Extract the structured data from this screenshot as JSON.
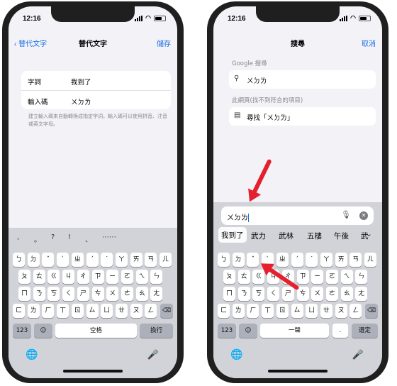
{
  "left": {
    "status": {
      "time": "12:16"
    },
    "nav": {
      "back": "替代文字",
      "title": "替代文字",
      "action": "儲存"
    },
    "form": {
      "phrase_label": "字詞",
      "phrase_value": "我到了",
      "input_label": "輸入碼",
      "input_value": "ㄨㄉㄌ"
    },
    "hint": "建立輸入碼來自動轉換成指定字詞。輸入碼可以使用拼音、注音或英文字母。",
    "punctuation": [
      ",",
      "。",
      "?",
      "!",
      "、",
      "⋯⋯"
    ],
    "space_label": "空格",
    "return_label": "換行"
  },
  "right": {
    "status": {
      "time": "12:16"
    },
    "nav": {
      "title": "搜尋",
      "action": "取消"
    },
    "google_label": "Google 搜尋",
    "google_query": "ㄨㄉㄌ",
    "page_label": "此網頁(找不到符合的項目)",
    "page_find": "尋找「ㄨㄉㄌ」",
    "search_text": "ㄨㄉㄌ",
    "suggestions": [
      "我到了",
      "武力",
      "武林",
      "五樓",
      "午後",
      "武"
    ],
    "space_label": "一聲",
    "dot_label": ".",
    "return_label": "選定"
  },
  "keyboard": {
    "row1": [
      "ㄅ",
      "ㄉ",
      "ˇ",
      "ˋ",
      "ㄓ",
      "ˊ",
      "˙",
      "ㄚ",
      "ㄞ",
      "ㄢ",
      "ㄦ"
    ],
    "row2": [
      "ㄆ",
      "ㄊ",
      "ㄍ",
      "ㄐ",
      "ㄔ",
      "ㄗ",
      "ㄧ",
      "ㄛ",
      "ㄟ",
      "ㄣ"
    ],
    "row3": [
      "ㄇ",
      "ㄋ",
      "ㄎ",
      "ㄑ",
      "ㄕ",
      "ㄘ",
      "ㄨ",
      "ㄜ",
      "ㄠ",
      "ㄤ"
    ],
    "row4": [
      "ㄈ",
      "ㄌ",
      "ㄏ",
      "ㄒ",
      "ㄖ",
      "ㄙ",
      "ㄩ",
      "ㄝ",
      "ㄡ",
      "ㄥ"
    ],
    "numbers_label": "123",
    "delete_icon": "⌫",
    "emoji_icon": "☺",
    "globe_icon": "🌐",
    "mic_icon": "🎤"
  },
  "colors": {
    "accent": "#1a6fe3",
    "arrow": "#e5202e"
  }
}
